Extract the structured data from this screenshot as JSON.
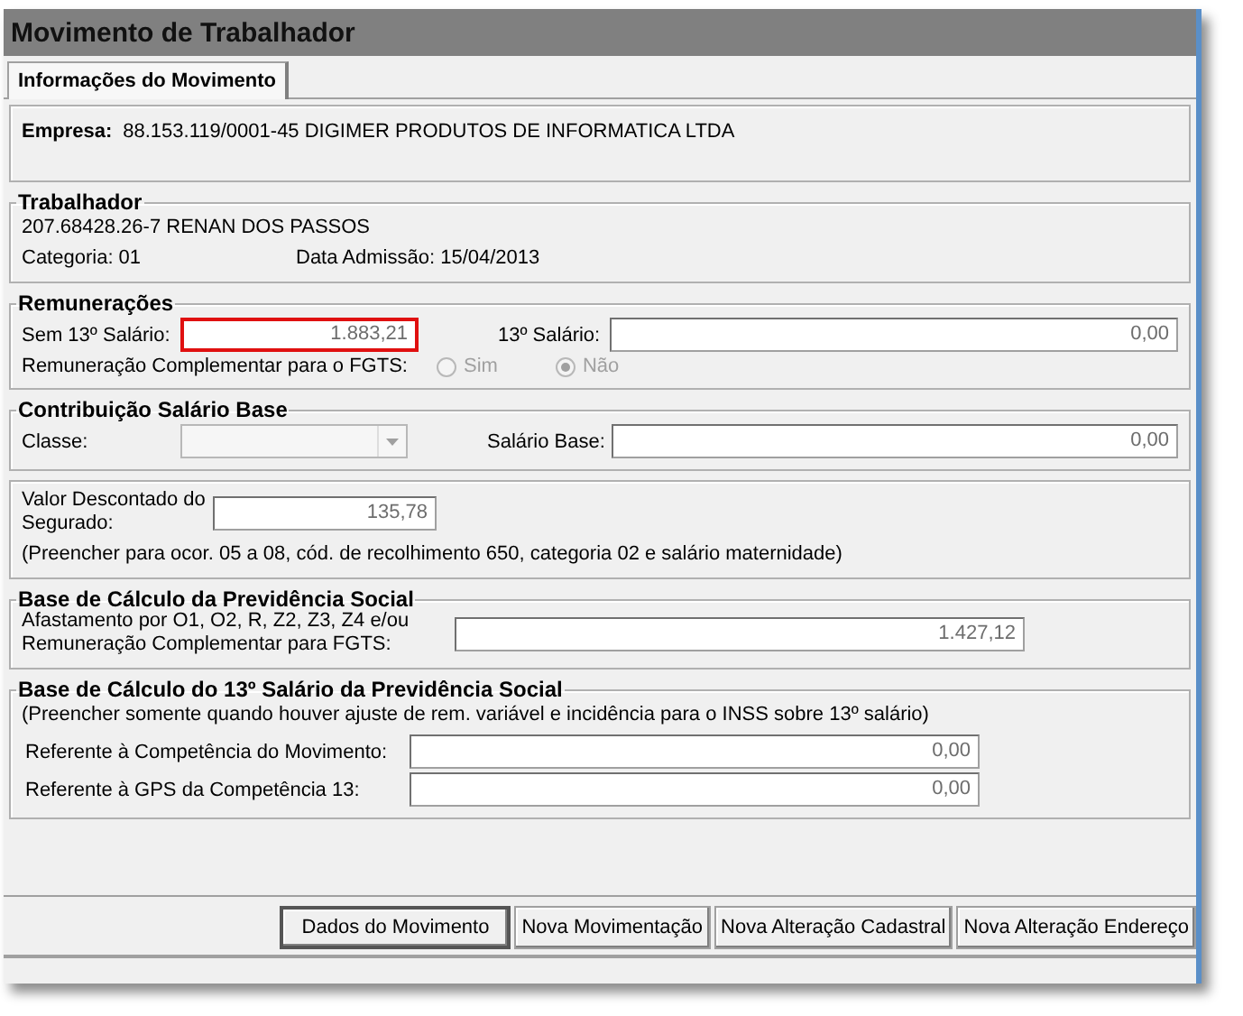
{
  "window": {
    "title": "Movimento de Trabalhador"
  },
  "tabs": [
    {
      "label": "Informações do Movimento",
      "selected": true
    }
  ],
  "empresa": {
    "label": "Empresa:",
    "value": "88.153.119/0001-45  DIGIMER PRODUTOS DE INFORMATICA LTDA"
  },
  "trabalhador": {
    "title": "Trabalhador",
    "name": "207.68428.26-7  RENAN DOS PASSOS",
    "categoria": "Categoria: 01",
    "admissao": "Data Admissão: 15/04/2013"
  },
  "remuneracoes": {
    "title": "Remunerações",
    "fields": [
      {
        "label": "Sem 13º Salário:",
        "value": "1.883,21",
        "highlighted": true
      },
      {
        "label": "13º Salário:",
        "value": "0,00",
        "highlighted": false
      }
    ],
    "fgts": {
      "label": "Remuneração Complementar para o FGTS:",
      "disabled": true,
      "options": [
        {
          "label": "Sim",
          "selected": false
        },
        {
          "label": "Não",
          "selected": true
        }
      ]
    }
  },
  "contribuicao": {
    "title": "Contribuição Salário Base",
    "classe": {
      "label": "Classe:",
      "disabled": true
    },
    "salario_base": {
      "label": "Salário Base:",
      "value": "0,00"
    }
  },
  "desconto": {
    "label": "Valor Descontado do Segurado:",
    "value": "135,78",
    "note": "(Preencher para ocor. 05 a 08, cód. de recolhimento 650, categoria 02 e salário maternidade)"
  },
  "base_previdencia": {
    "title": "Base de Cálculo da Previdência Social",
    "label": "Afastamento por O1, O2, R, Z2, Z3, Z4 e/ou Remuneração Complementar para FGTS:",
    "value": "1.427,12"
  },
  "base_13": {
    "title": "Base de Cálculo do 13º Salário da Previdência Social",
    "note": "(Preencher somente quando houver ajuste de rem. variável e incidência para o INSS sobre 13º salário)",
    "fields": [
      {
        "label": "Referente à Competência do Movimento:",
        "value": "0,00"
      },
      {
        "label": "Referente à GPS da Competência 13:",
        "value": "0,00"
      }
    ]
  },
  "buttons": [
    {
      "label": "Dados do Movimento",
      "default": true
    },
    {
      "label": "Nova Movimentação",
      "default": false
    },
    {
      "label": "Nova Alteração Cadastral",
      "default": false
    },
    {
      "label": "Nova Alteração Endereço",
      "default": false
    }
  ]
}
